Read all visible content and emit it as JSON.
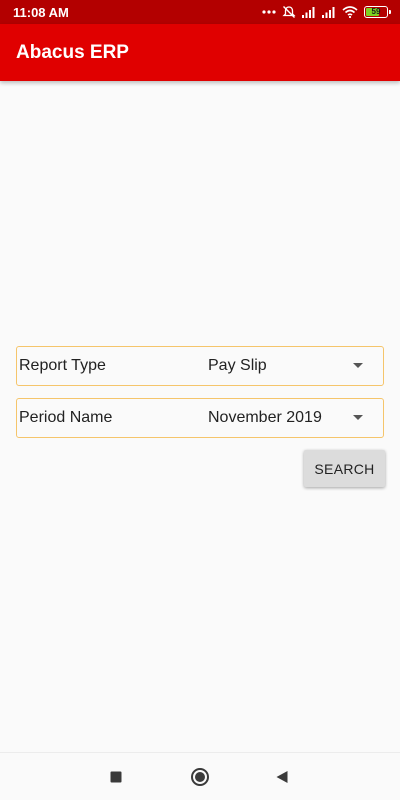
{
  "status_bar": {
    "time": "11:08 AM",
    "battery_level": "59",
    "icons": [
      "more-dots-icon",
      "alarm-off-icon",
      "signal-icon",
      "signal-icon",
      "wifi-icon",
      "battery-icon"
    ]
  },
  "app_bar": {
    "title": "Abacus ERP"
  },
  "form": {
    "report_type": {
      "label": "Report Type",
      "value": "Pay Slip"
    },
    "period_name": {
      "label": "Period Name",
      "value": "November 2019"
    },
    "search_label": "SEARCH"
  },
  "colors": {
    "app_bar": "#e00000",
    "status_bar": "#b30000",
    "field_border": "#f5c56b",
    "button_bg": "#dcdcdc"
  },
  "nav_bar": {
    "buttons": [
      "recent-apps-icon",
      "home-icon",
      "back-icon"
    ]
  }
}
